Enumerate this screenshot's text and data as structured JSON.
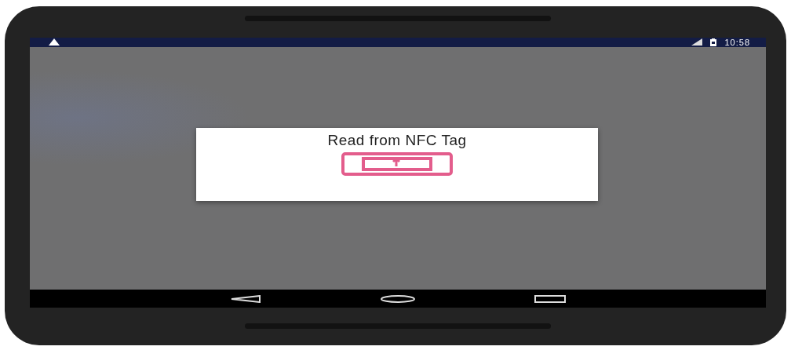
{
  "status_bar": {
    "time": "10:58"
  },
  "dialog": {
    "title": "Read from NFC Tag"
  }
}
